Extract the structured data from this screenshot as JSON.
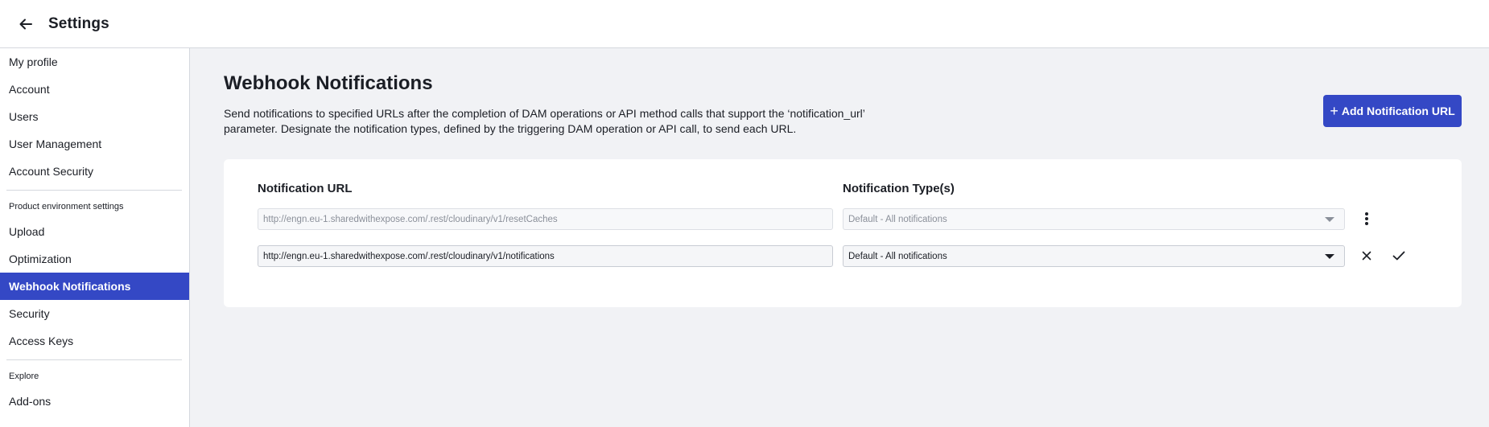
{
  "header": {
    "title": "Settings",
    "back_icon": "arrow-left-icon"
  },
  "sidebar": {
    "items": [
      {
        "label": "My profile"
      },
      {
        "label": "Account"
      },
      {
        "label": "Users"
      },
      {
        "label": "User Management"
      },
      {
        "label": "Account Security"
      }
    ],
    "section_product": "Product environment settings",
    "product_items": [
      {
        "label": "Upload"
      },
      {
        "label": "Optimization"
      },
      {
        "label": "Webhook Notifications",
        "active": true
      },
      {
        "label": "Security"
      },
      {
        "label": "Access Keys"
      }
    ],
    "section_explore": "Explore",
    "explore_items": [
      {
        "label": "Add-ons"
      }
    ]
  },
  "main": {
    "title": "Webhook Notifications",
    "description": "Send notifications to specified URLs after the completion of DAM operations or API method calls that support the ‘notification_url’ parameter. Designate the notification types, defined by the triggering DAM operation or API call, to send each URL.",
    "add_button_label": "Add Notification URL",
    "col_url": "Notification URL",
    "col_types": "Notification Type(s)",
    "rows": [
      {
        "url": "http://engn.eu-1.sharedwithexpose.com/.rest/cloudinary/v1/resetCaches",
        "type": "Default - All notifications",
        "state": "saved"
      },
      {
        "url": "http://engn.eu-1.sharedwithexpose.com/.rest/cloudinary/v1/notifications",
        "type": "Default - All notifications",
        "state": "editing"
      }
    ]
  },
  "colors": {
    "accent": "#3448c5",
    "background": "#f1f2f5",
    "text": "#1b1e25"
  }
}
